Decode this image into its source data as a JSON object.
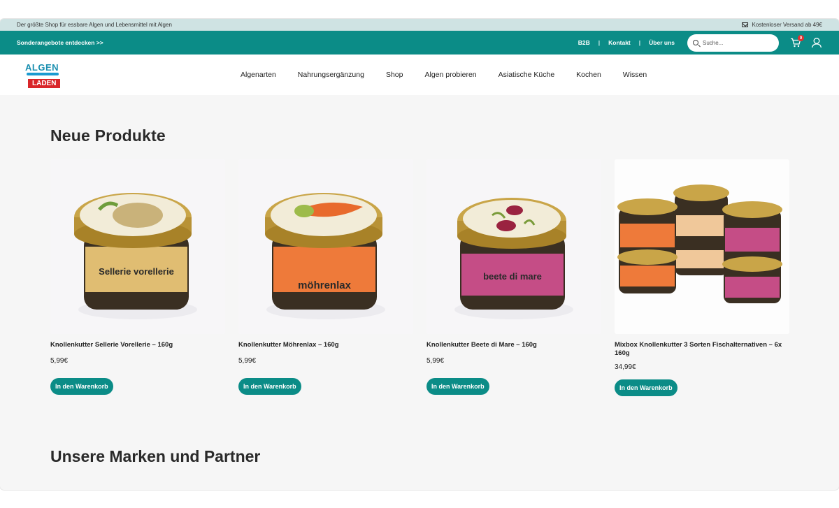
{
  "topinfo": {
    "tagline": "Der größte Shop für essbare Algen und Lebensmittel mit Algen",
    "shipping": "Kostenloser Versand ab 49€"
  },
  "greenbar": {
    "offers_link": "Sonderangebote entdecken >>",
    "links": [
      "B2B",
      "Kontakt",
      "Über uns"
    ],
    "separator": "|",
    "search_placeholder": "Suche...",
    "cart_count": "0"
  },
  "logo": {
    "top": "ALGEN",
    "bottom": "LADEN"
  },
  "menu": [
    "Algenarten",
    "Nahrungsergänzung",
    "Shop",
    "Algen probieren",
    "Asiatische Küche",
    "Kochen",
    "Wissen"
  ],
  "sections": {
    "new_products": "Neue Produkte",
    "brands": "Unsere Marken und Partner"
  },
  "products": [
    {
      "name": "Knollenkutter Sellerie Vorellerie – 160g",
      "price": "5,99€",
      "button": "In den Warenkorb",
      "jar_label": "Sellerie vorellerie",
      "label_color": "#e0bd72"
    },
    {
      "name": "Knollenkutter Möhrenlax – 160g",
      "price": "5,99€",
      "button": "In den Warenkorb",
      "jar_label": "möhrenlax",
      "label_color": "#ee7a3a"
    },
    {
      "name": "Knollenkutter Beete di Mare – 160g",
      "price": "5,99€",
      "button": "In den Warenkorb",
      "jar_label": "beete di mare",
      "label_color": "#c54d86"
    },
    {
      "name": "Mixbox Knollenkutter 3 Sorten Fischalternativen – 6x 160g",
      "price": "34,99€",
      "button": "In den Warenkorb"
    }
  ],
  "colors": {
    "brand_green": "#0b8c87",
    "topinfo_bg": "#cfe3e3",
    "page_bg": "#f6f6f6"
  }
}
